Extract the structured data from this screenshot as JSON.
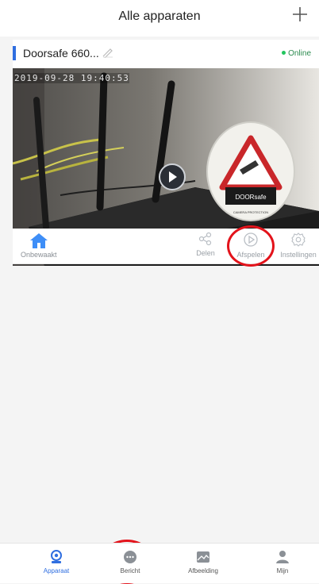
{
  "header": {
    "title": "Alle apparaten",
    "add_icon": "plus-icon"
  },
  "device": {
    "name": "Doorsafe 660...",
    "status": "Online",
    "status_color": "#22c55e",
    "timestamp": "2019-09-28  19:40:53",
    "sticker_brand": "DOORsafe",
    "sticker_caption": "CAMERA PROTECTION"
  },
  "actions": {
    "mode_label": "Onbewaakt",
    "share_label": "Delen",
    "playback_label": "Afspelen",
    "settings_label": "Instellingen"
  },
  "bottom_nav": {
    "items": [
      {
        "label": "Apparaat",
        "icon": "camera-icon",
        "active": true
      },
      {
        "label": "Bericht",
        "icon": "chat-icon",
        "active": false
      },
      {
        "label": "Afbeelding",
        "icon": "image-icon",
        "active": false
      },
      {
        "label": "Mijn",
        "icon": "user-icon",
        "active": false
      }
    ]
  },
  "accent_color": "#2f6ee0",
  "highlight_color": "#e3131b"
}
